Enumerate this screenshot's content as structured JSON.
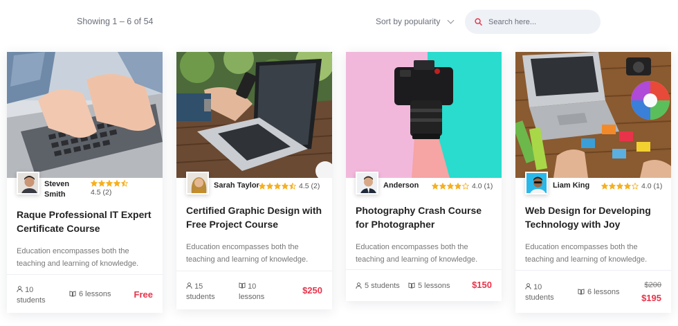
{
  "toolbar": {
    "showing": "Showing 1 – 6 of 54",
    "sort_label": "Sort by popularity",
    "search_placeholder": "Search here..."
  },
  "colors": {
    "accent": "#e8334a",
    "star": "#f6b01e",
    "search_bg": "#eef1f6"
  },
  "courses": [
    {
      "author": "Steven Smith",
      "author_line1": "Steven",
      "author_line2": "Smith",
      "stars": 4.5,
      "rating": "4.5 (2)",
      "title": "Raque Professional IT Expert Certificate Course",
      "description": "Education encompasses both the teaching and learning of knowledge.",
      "students_num": "10",
      "students_word": "students",
      "lessons": "6 lessons",
      "price": "Free",
      "image": "hands-typing-laptop"
    },
    {
      "author": "Sarah Taylor",
      "stars": 4.5,
      "rating": "4.5 (2)",
      "title": "Certified Graphic Design with Free Project Course",
      "description": "Education encompasses both the teaching and learning of knowledge.",
      "students_num": "15",
      "students_word": "students",
      "lessons_num": "10",
      "lessons_word": "lessons",
      "price": "$250",
      "image": "laptop-phone-hand"
    },
    {
      "author": "Anderson",
      "stars": 4.0,
      "rating": "4.0 (1)",
      "title": "Photography Crash Course for Photographer",
      "description": "Education encompasses both the teaching and learning of knowledge.",
      "students": "5 students",
      "lessons": "5 lessons",
      "price": "$150",
      "image": "camera-pink-teal"
    },
    {
      "author": "Liam King",
      "stars": 4.0,
      "rating": "4.0 (1)",
      "title": "Web Design for Developing Technology with Joy",
      "description": "Education encompasses both the teaching and learning of knowledge.",
      "students_num": "10",
      "students_word": "students",
      "lessons": "6 lessons",
      "old_price": "$200",
      "price": "$195",
      "image": "design-desk-color-swatches"
    }
  ]
}
